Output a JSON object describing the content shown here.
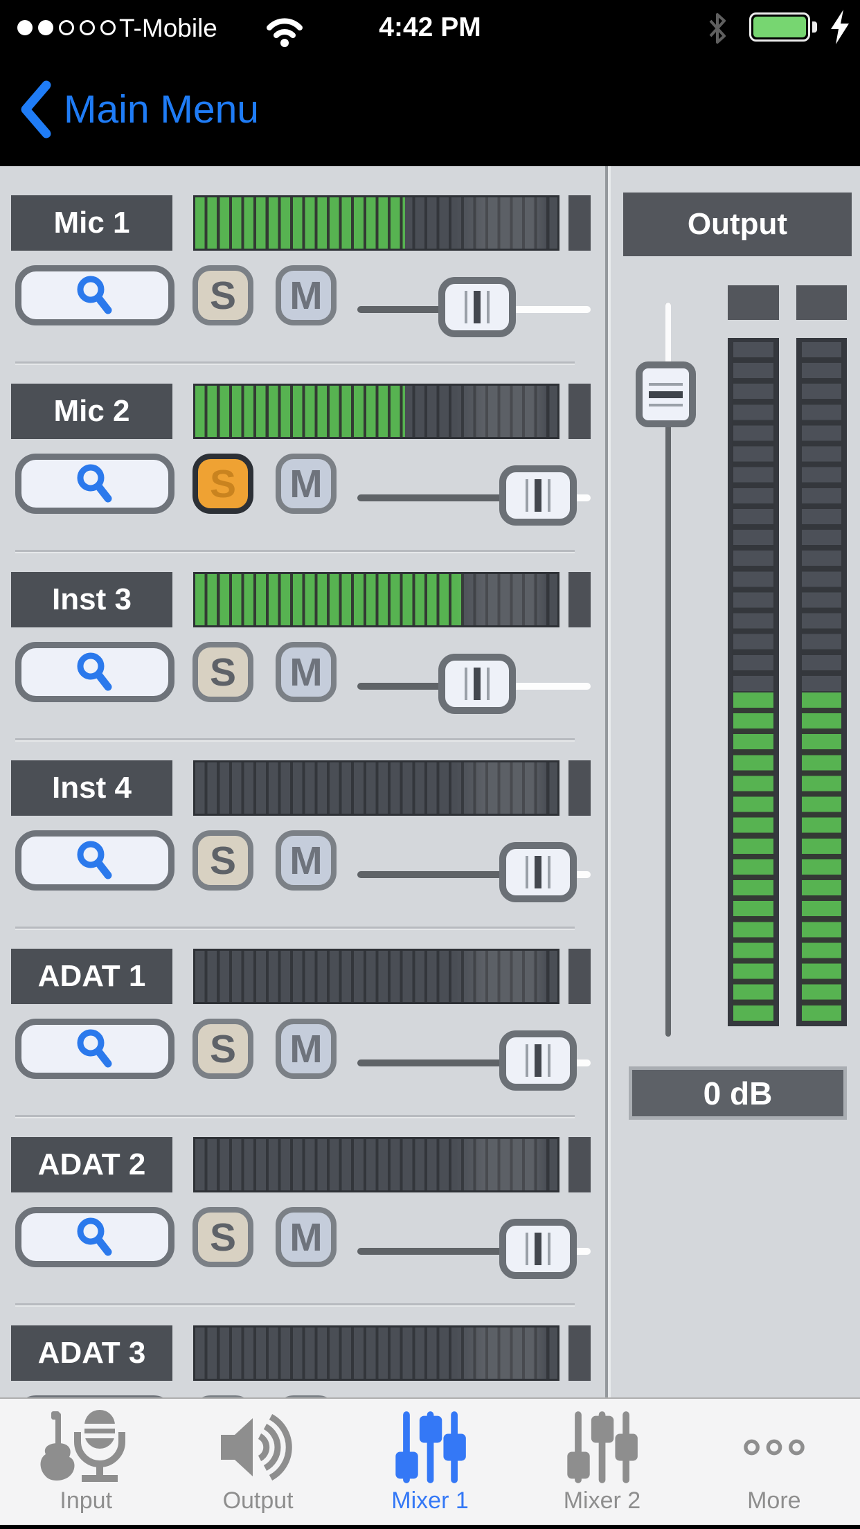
{
  "colors": {
    "accent_blue": "#1f7cf6",
    "tab_active_blue": "#3478f6",
    "meter_green": "#57b351",
    "solo_active_orange": "#efa233",
    "battery_green": "#77d671",
    "panel_dark": "#4b4f55",
    "background": "#d4d7db"
  },
  "status_bar": {
    "signal": {
      "filled_dots": 2,
      "total_dots": 5
    },
    "carrier": "T-Mobile",
    "time": "4:42 PM",
    "wifi_icon": "wifi-icon",
    "bluetooth_icon": "bluetooth-icon",
    "battery_icon": "battery-charging-icon"
  },
  "nav_bar": {
    "back_label": "Main Menu",
    "back_icon": "chevron-left-icon"
  },
  "mixer": {
    "solo_label": "S",
    "mute_label": "M",
    "search_icon": "magnifier-icon",
    "channels": [
      {
        "name": "Mic 1",
        "level_pct": 58,
        "fader_pct": 52,
        "solo": false,
        "mute": false
      },
      {
        "name": "Mic 2",
        "level_pct": 58,
        "fader_pct": 91,
        "solo": true,
        "mute": false
      },
      {
        "name": "Inst 3",
        "level_pct": 74,
        "fader_pct": 52,
        "solo": false,
        "mute": false
      },
      {
        "name": "Inst 4",
        "level_pct": 0,
        "fader_pct": 91,
        "solo": false,
        "mute": false
      },
      {
        "name": "ADAT 1",
        "level_pct": 0,
        "fader_pct": 91,
        "solo": false,
        "mute": false
      },
      {
        "name": "ADAT 2",
        "level_pct": 0,
        "fader_pct": 91,
        "solo": false,
        "mute": false
      },
      {
        "name": "ADAT 3",
        "level_pct": 0,
        "fader_pct": 91,
        "solo": false,
        "mute": false
      }
    ]
  },
  "output_section": {
    "title": "Output",
    "gain_label": "0 dB",
    "fader_pct_from_top": 12.5,
    "meter": {
      "segments_total": 33,
      "segments_lit": 16,
      "channels": 2
    }
  },
  "tab_bar": {
    "tabs": [
      {
        "label": "Input",
        "icon": "guitar-mic-icon",
        "active": false
      },
      {
        "label": "Output",
        "icon": "speaker-icon",
        "active": false
      },
      {
        "label": "Mixer 1",
        "icon": "faders-icon",
        "active": true
      },
      {
        "label": "Mixer 2",
        "icon": "faders-icon",
        "active": false
      },
      {
        "label": "More",
        "icon": "ellipsis-icon",
        "active": false
      }
    ]
  }
}
